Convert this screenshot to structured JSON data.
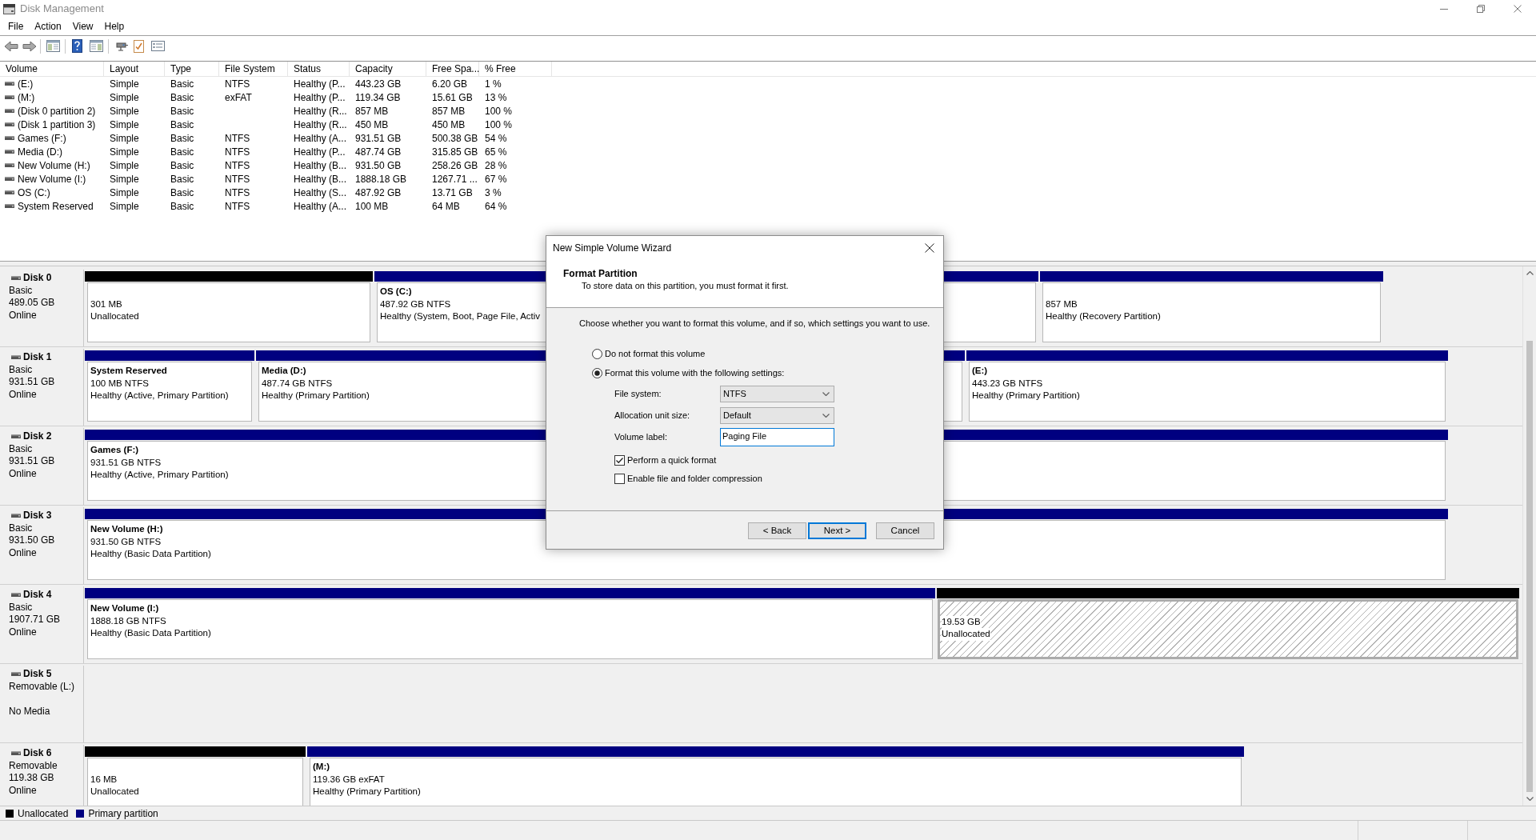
{
  "window": {
    "title": "Disk Management"
  },
  "menu": [
    "File",
    "Action",
    "View",
    "Help"
  ],
  "volume_table": {
    "columns": [
      "Volume",
      "Layout",
      "Type",
      "File System",
      "Status",
      "Capacity",
      "Free Spa...",
      "% Free"
    ],
    "rows": [
      {
        "volume": "(E:)",
        "layout": "Simple",
        "type": "Basic",
        "file_system": "NTFS",
        "status": "Healthy (P...",
        "capacity": "443.23 GB",
        "free_space": "6.20 GB",
        "percent_free": "1 %"
      },
      {
        "volume": "(M:)",
        "layout": "Simple",
        "type": "Basic",
        "file_system": "exFAT",
        "status": "Healthy (P...",
        "capacity": "119.34 GB",
        "free_space": "15.61 GB",
        "percent_free": "13 %"
      },
      {
        "volume": "(Disk 0 partition 2)",
        "layout": "Simple",
        "type": "Basic",
        "status": "Healthy (R...",
        "capacity": "857 MB",
        "free_space": "857 MB",
        "percent_free": "100 %"
      },
      {
        "volume": "(Disk 1 partition 3)",
        "layout": "Simple",
        "type": "Basic",
        "status": "Healthy (R...",
        "capacity": "450 MB",
        "free_space": "450 MB",
        "percent_free": "100 %"
      },
      {
        "volume": "Games (F:)",
        "layout": "Simple",
        "type": "Basic",
        "file_system": "NTFS",
        "status": "Healthy (A...",
        "capacity": "931.51 GB",
        "free_space": "500.38 GB",
        "percent_free": "54 %"
      },
      {
        "volume": "Media (D:)",
        "layout": "Simple",
        "type": "Basic",
        "file_system": "NTFS",
        "status": "Healthy (P...",
        "capacity": "487.74 GB",
        "free_space": "315.85 GB",
        "percent_free": "65 %"
      },
      {
        "volume": "New Volume (H:)",
        "layout": "Simple",
        "type": "Basic",
        "file_system": "NTFS",
        "status": "Healthy (B...",
        "capacity": "931.50 GB",
        "free_space": "258.26 GB",
        "percent_free": "28 %"
      },
      {
        "volume": "New Volume (I:)",
        "layout": "Simple",
        "type": "Basic",
        "file_system": "NTFS",
        "status": "Healthy (B...",
        "capacity": "1888.18 GB",
        "free_space": "1267.71 ...",
        "percent_free": "67 %"
      },
      {
        "volume": "OS (C:)",
        "layout": "Simple",
        "type": "Basic",
        "file_system": "NTFS",
        "status": "Healthy (S...",
        "capacity": "487.92 GB",
        "free_space": "13.71 GB",
        "percent_free": "3 %"
      },
      {
        "volume": "System Reserved",
        "layout": "Simple",
        "type": "Basic",
        "file_system": "NTFS",
        "status": "Healthy (A...",
        "capacity": "100 MB",
        "free_space": "64 MB",
        "percent_free": "64 %"
      }
    ]
  },
  "disks": [
    {
      "name": "Disk 0",
      "details": [
        "Basic",
        "489.05 GB"
      ],
      "status": "Online",
      "partitions": [
        {
          "kind": "unallocated",
          "selected": false,
          "lines": [
            "301 MB",
            "Unallocated"
          ]
        },
        {
          "kind": "primary",
          "selected": false,
          "title": "OS (C:)",
          "lines": [
            "487.92 GB NTFS",
            "Healthy (System, Boot, Page File, Activ"
          ]
        },
        {
          "kind": "primary",
          "selected": false,
          "lines": [
            "857 MB",
            "Healthy (Recovery Partition)"
          ]
        }
      ]
    },
    {
      "name": "Disk 1",
      "details": [
        "Basic",
        "931.51 GB"
      ],
      "status": "Online",
      "partitions": [
        {
          "kind": "primary",
          "selected": false,
          "title": "System Reserved",
          "lines": [
            "100 MB NTFS",
            "Healthy (Active, Primary Partition)"
          ]
        },
        {
          "kind": "primary",
          "selected": false,
          "title": "Media (D:)",
          "lines": [
            "487.74 GB NTFS",
            "Healthy (Primary Partition)"
          ]
        },
        {
          "kind": "primary",
          "selected": false,
          "title": "(E:)",
          "lines": [
            "443.23 GB NTFS",
            "Healthy (Primary Partition)"
          ]
        }
      ]
    },
    {
      "name": "Disk 2",
      "details": [
        "Basic",
        "931.51 GB"
      ],
      "status": "Online",
      "partitions": [
        {
          "kind": "primary",
          "selected": false,
          "title": "Games (F:)",
          "lines": [
            "931.51 GB NTFS",
            "Healthy (Active, Primary Partition)"
          ]
        }
      ]
    },
    {
      "name": "Disk 3",
      "details": [
        "Basic",
        "931.50 GB"
      ],
      "status": "Online",
      "partitions": [
        {
          "kind": "primary",
          "selected": false,
          "title": "New Volume (H:)",
          "lines": [
            "931.50 GB NTFS",
            "Healthy (Basic Data Partition)"
          ]
        }
      ]
    },
    {
      "name": "Disk 4",
      "details": [
        "Basic",
        "1907.71 GB"
      ],
      "status": "Online",
      "partitions": [
        {
          "kind": "primary",
          "selected": false,
          "title": "New Volume (I:)",
          "lines": [
            "1888.18 GB NTFS",
            "Healthy (Basic Data Partition)"
          ]
        },
        {
          "kind": "unallocated",
          "selected": true,
          "lines": [
            "19.53 GB",
            "Unallocated"
          ]
        }
      ]
    },
    {
      "name": "Disk 5",
      "details": [
        "Removable (L:)"
      ],
      "status": "No Media"
    },
    {
      "name": "Disk 6",
      "details": [
        "Removable",
        "119.38 GB"
      ],
      "status": "Online",
      "partitions": [
        {
          "kind": "unallocated",
          "selected": false,
          "lines": [
            "16 MB",
            "Unallocated"
          ]
        },
        {
          "kind": "primary",
          "selected": false,
          "title": "(M:)",
          "lines": [
            "119.36 GB exFAT",
            "Healthy (Primary Partition)"
          ]
        }
      ]
    }
  ],
  "legend": [
    {
      "label": "Unallocated",
      "color": "#000000"
    },
    {
      "label": "Primary partition",
      "color": "#000080"
    }
  ],
  "dialog": {
    "title": "New Simple Volume Wizard",
    "heading": "Format Partition",
    "subheading": "To store data on this partition, you must format it first.",
    "instruction": "Choose whether you want to format this volume, and if so, which settings you want to use.",
    "format_options": [
      {
        "label": "Do not format this volume",
        "selected": false
      },
      {
        "label": "Format this volume with the following settings:",
        "selected": true
      }
    ],
    "settings": [
      {
        "kind": "dropdown",
        "label": "File system:",
        "value": "NTFS",
        "focused": false
      },
      {
        "kind": "dropdown",
        "label": "Allocation unit size:",
        "value": "Default",
        "focused": false
      },
      {
        "kind": "text",
        "label": "Volume label:",
        "value": "Paging File",
        "focused": true
      }
    ],
    "checkboxes": [
      {
        "label": "Perform a quick format",
        "checked": true
      },
      {
        "label": "Enable file and folder compression",
        "checked": false
      }
    ],
    "buttons": [
      {
        "label": "< Back",
        "default": false
      },
      {
        "label": "Next >",
        "default": true
      },
      {
        "label": "Cancel",
        "default": false
      }
    ]
  }
}
